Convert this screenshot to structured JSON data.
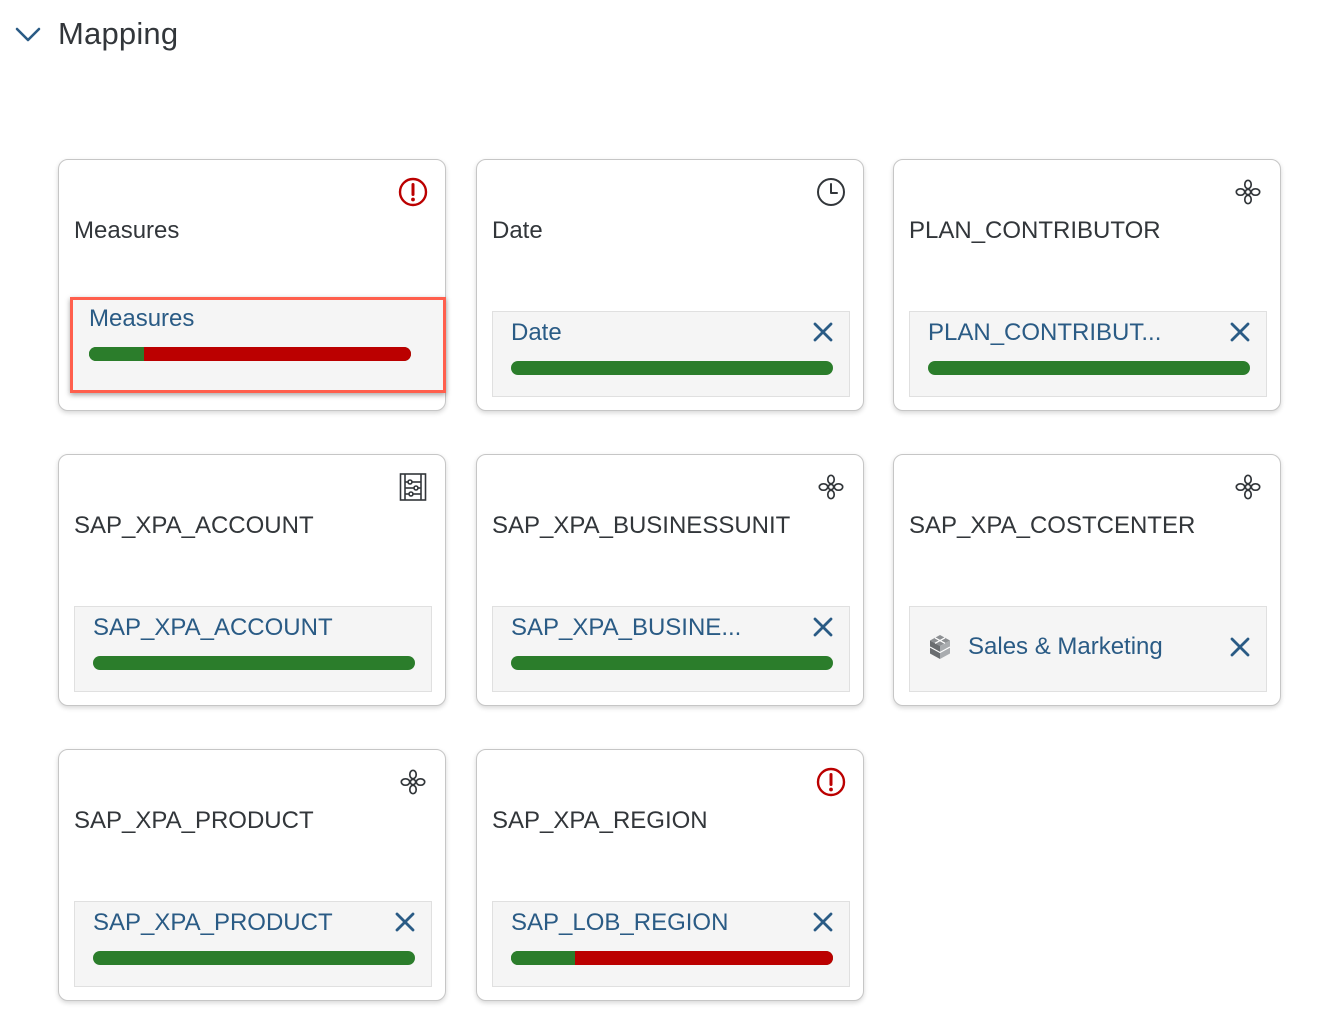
{
  "section": {
    "title": "Mapping"
  },
  "cards": [
    {
      "title": "Measures",
      "icon": "error-icon",
      "mapping": "Measures",
      "coverage_ok": 0.17,
      "status": "error",
      "has_close": false,
      "selected": true
    },
    {
      "title": "Date",
      "icon": "clock-icon",
      "mapping": "Date",
      "coverage_ok": 1.0,
      "status": "ok",
      "has_close": true
    },
    {
      "title": "PLAN_CONTRIBUTOR",
      "icon": "hierarchy-icon",
      "mapping": "PLAN_CONTRIBUT...",
      "coverage_ok": 1.0,
      "status": "ok",
      "has_close": true
    },
    {
      "title": "SAP_XPA_ACCOUNT",
      "icon": "account-icon",
      "mapping": "SAP_XPA_ACCOUNT",
      "coverage_ok": 1.0,
      "status": "ok",
      "has_close": false
    },
    {
      "title": "SAP_XPA_BUSINESSUNIT",
      "icon": "hierarchy-icon",
      "mapping": "SAP_XPA_BUSINE...",
      "coverage_ok": 1.0,
      "status": "ok",
      "has_close": true
    },
    {
      "title": "SAP_XPA_COSTCENTER",
      "icon": "hierarchy-icon",
      "mapping": "Sales & Marketing",
      "mapping_icon": "cube-icon",
      "has_close": true
    },
    {
      "title": "SAP_XPA_PRODUCT",
      "icon": "hierarchy-icon",
      "mapping": "SAP_XPA_PRODUCT",
      "coverage_ok": 1.0,
      "status": "ok",
      "has_close": true
    },
    {
      "title": "SAP_XPA_REGION",
      "icon": "error-icon",
      "mapping": "SAP_LOB_REGION",
      "coverage_ok": 0.2,
      "status": "error",
      "has_close": true
    }
  ],
  "colors": {
    "ok": "#2b7d2b",
    "error": "#bb0000",
    "link": "#2a5b85",
    "highlight": "#ff5f4d"
  }
}
